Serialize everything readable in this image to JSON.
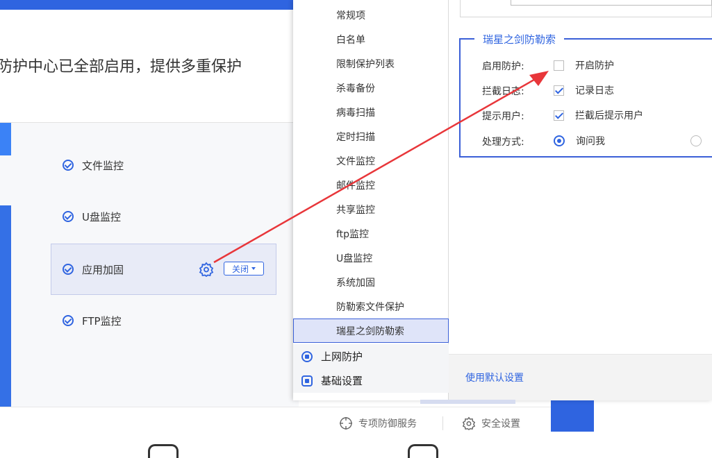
{
  "main": {
    "banner_text": "防护中心已全部启用，提供多重保护",
    "features": [
      {
        "label": "文件监控"
      },
      {
        "label": "U盘监控"
      },
      {
        "label": "应用加固",
        "toggle_label": "关闭"
      },
      {
        "label": "FTP监控"
      }
    ],
    "bottom_links": {
      "special_service": "专项防御服务",
      "security_settings": "安全设置"
    }
  },
  "dialog": {
    "nav_items": [
      "常规项",
      "白名单",
      "限制保护列表",
      "杀毒备份",
      "病毒扫描",
      "定时扫描",
      "文件监控",
      "邮件监控",
      "共享监控",
      "ftp监控",
      "U盘监控",
      "系统加固",
      "防勒索文件保护",
      "瑞星之剑防勒索"
    ],
    "nav_groups": [
      "上网防护",
      "基础设置"
    ],
    "group_title": "瑞星之剑防勒索",
    "rows": {
      "enable": {
        "label": "启用防护:",
        "option": "开启防护",
        "checked": false
      },
      "log": {
        "label": "拦截日志:",
        "option": "记录日志",
        "checked": true
      },
      "notify": {
        "label": "提示用户:",
        "option": "拦截后提示用户",
        "checked": true
      },
      "action": {
        "label": "处理方式:",
        "option": "询问我",
        "selected": true
      }
    },
    "default_link": "使用默认设置"
  },
  "colors": {
    "accent": "#2f64e0",
    "selection_bg": "#dfe4f9",
    "annotation_arrow": "#e8363a"
  }
}
